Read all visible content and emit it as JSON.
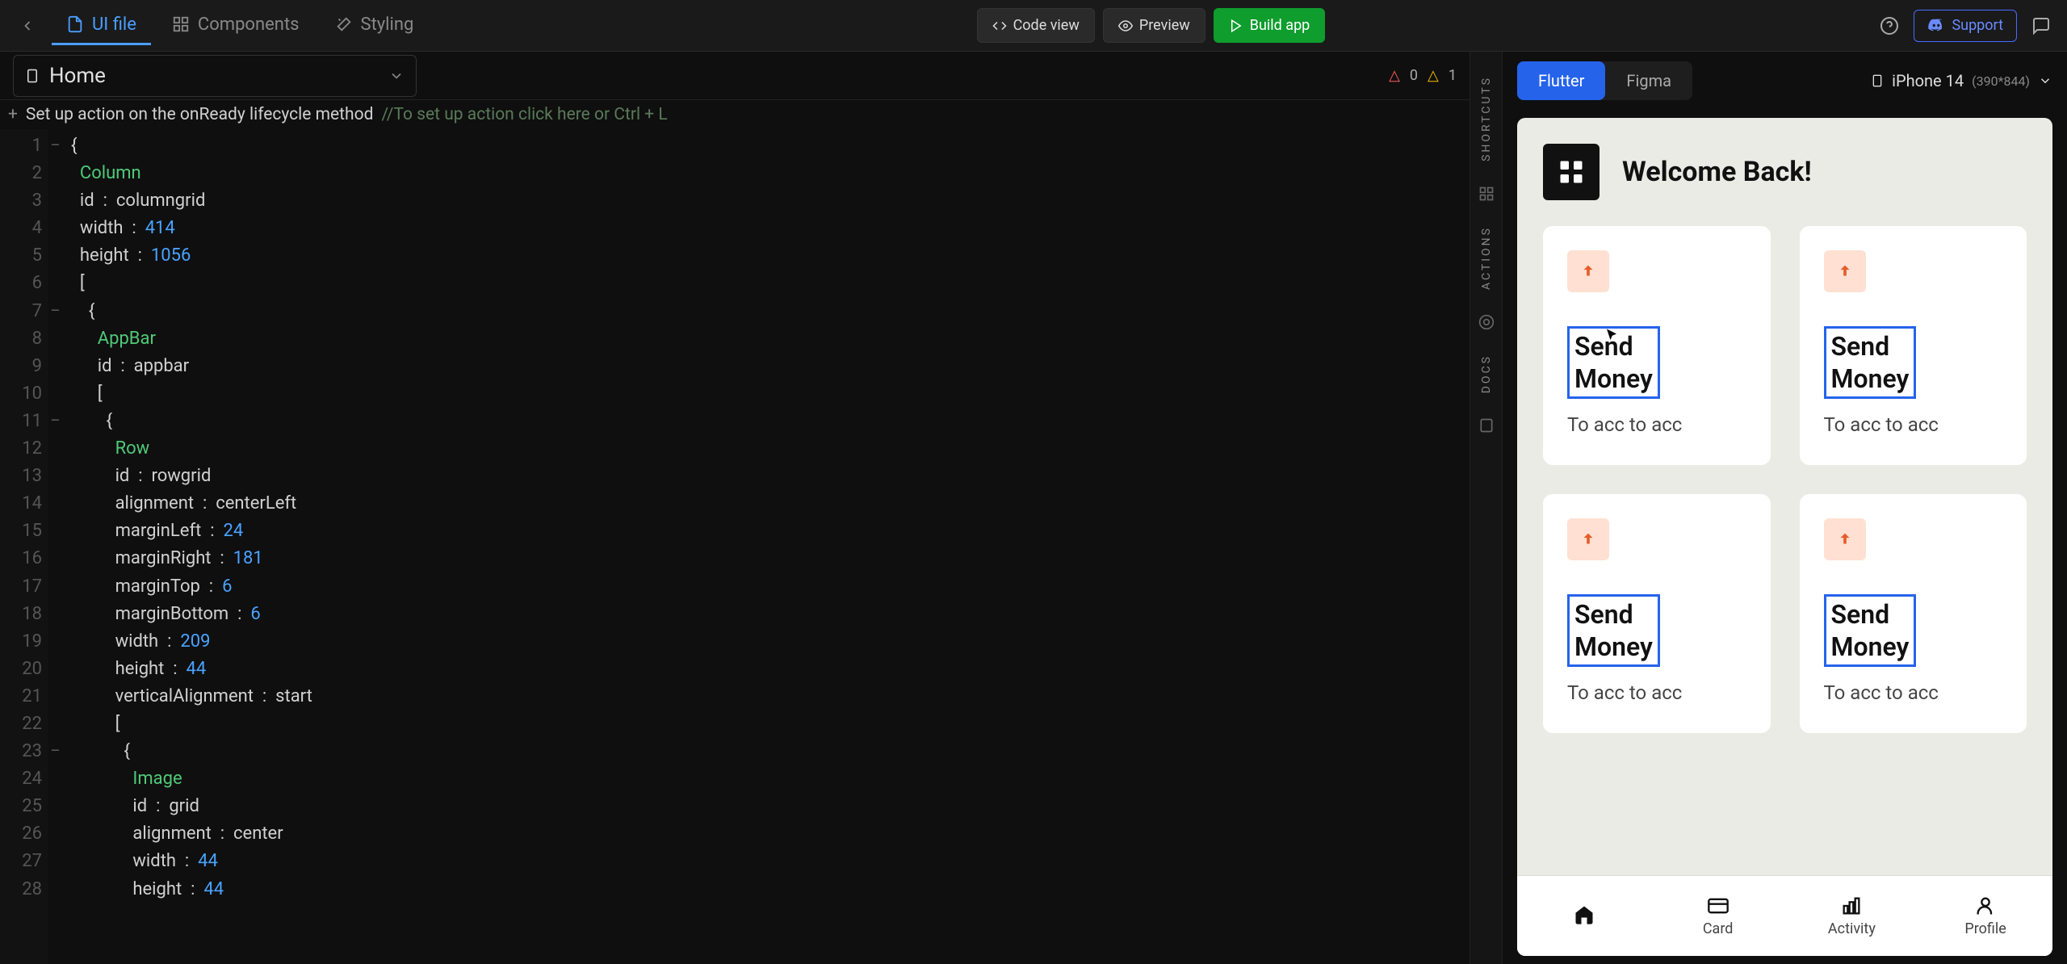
{
  "topbar": {
    "tabs": [
      "UI file",
      "Components",
      "Styling"
    ],
    "code_view": "Code view",
    "preview": "Preview",
    "build": "Build app",
    "support": "Support"
  },
  "editor": {
    "file": "Home",
    "errors": "0",
    "warnings": "1",
    "action_prefix": "+",
    "action_text": "Set up action on the onReady lifecycle method",
    "action_comment": "//To set up action click here or Ctrl + L",
    "line_numbers": "1\n2\n3\n4\n5\n6\n7\n8\n9\n10\n11\n12\n13\n14\n15\n16\n17\n18\n19\n20\n21\n22\n23\n24\n25\n26\n27\n28",
    "fold_marks": "−\n\n\n\n\n\n−\n\n\n\n−\n\n\n\n\n\n\n\n\n\n\n\n−\n\n\n\n\n",
    "code_lines": [
      {
        "indent": 0,
        "type": "brace",
        "t": "{"
      },
      {
        "indent": 1,
        "type": "key",
        "t": "Column"
      },
      {
        "indent": 1,
        "type": "prop",
        "k": "id",
        "v": "columngrid",
        "vt": "plain"
      },
      {
        "indent": 1,
        "type": "prop",
        "k": "width",
        "v": "414",
        "vt": "num"
      },
      {
        "indent": 1,
        "type": "prop",
        "k": "height",
        "v": "1056",
        "vt": "num"
      },
      {
        "indent": 1,
        "type": "brace",
        "t": "["
      },
      {
        "indent": 2,
        "type": "brace",
        "t": "{"
      },
      {
        "indent": 3,
        "type": "key",
        "t": "AppBar"
      },
      {
        "indent": 3,
        "type": "prop",
        "k": "id",
        "v": "appbar",
        "vt": "plain"
      },
      {
        "indent": 3,
        "type": "brace",
        "t": "["
      },
      {
        "indent": 4,
        "type": "brace",
        "t": "{"
      },
      {
        "indent": 5,
        "type": "key",
        "t": "Row"
      },
      {
        "indent": 5,
        "type": "prop",
        "k": "id",
        "v": "rowgrid",
        "vt": "plain"
      },
      {
        "indent": 5,
        "type": "prop",
        "k": "alignment",
        "v": "centerLeft",
        "vt": "plain"
      },
      {
        "indent": 5,
        "type": "prop",
        "k": "marginLeft",
        "v": "24",
        "vt": "num"
      },
      {
        "indent": 5,
        "type": "prop",
        "k": "marginRight",
        "v": "181",
        "vt": "num"
      },
      {
        "indent": 5,
        "type": "prop",
        "k": "marginTop",
        "v": "6",
        "vt": "num"
      },
      {
        "indent": 5,
        "type": "prop",
        "k": "marginBottom",
        "v": "6",
        "vt": "num"
      },
      {
        "indent": 5,
        "type": "prop",
        "k": "width",
        "v": "209",
        "vt": "num"
      },
      {
        "indent": 5,
        "type": "prop",
        "k": "height",
        "v": "44",
        "vt": "num"
      },
      {
        "indent": 5,
        "type": "prop",
        "k": "verticalAlignment",
        "v": "start",
        "vt": "plain"
      },
      {
        "indent": 5,
        "type": "brace",
        "t": "["
      },
      {
        "indent": 6,
        "type": "brace",
        "t": "{"
      },
      {
        "indent": 7,
        "type": "key",
        "t": "Image"
      },
      {
        "indent": 7,
        "type": "prop",
        "k": "id",
        "v": "grid",
        "vt": "plain"
      },
      {
        "indent": 7,
        "type": "prop",
        "k": "alignment",
        "v": "center",
        "vt": "plain"
      },
      {
        "indent": 7,
        "type": "prop",
        "k": "width",
        "v": "44",
        "vt": "num"
      },
      {
        "indent": 7,
        "type": "prop",
        "k": "height",
        "v": "44",
        "vt": "num"
      }
    ]
  },
  "rail": {
    "shortcuts": "SHORTCUTS",
    "actions": "ACTIONS",
    "docs": "DOCS"
  },
  "preview": {
    "tabs": [
      "Flutter",
      "Figma"
    ],
    "device": "iPhone 14",
    "device_dim": "(390*844)",
    "welcome": "Welcome Back!",
    "cards": [
      {
        "title": "Send Money",
        "sub": "To acc to acc"
      },
      {
        "title": "Send Money",
        "sub": "To acc to acc"
      },
      {
        "title": "Send Money",
        "sub": "To acc to acc"
      },
      {
        "title": "Send Money",
        "sub": "To acc to acc"
      }
    ],
    "nav": [
      "",
      "Card",
      "Activity",
      "Profile"
    ]
  }
}
